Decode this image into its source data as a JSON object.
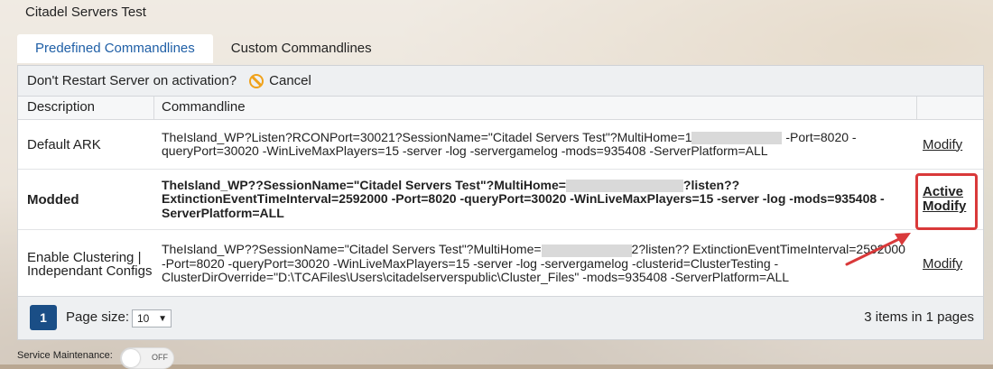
{
  "title": "Citadel Servers Test",
  "tabs": [
    {
      "label": "Predefined Commandlines",
      "active": true
    },
    {
      "label": "Custom Commandlines",
      "active": false
    }
  ],
  "toolbar": {
    "restart_text": "Don't Restart Server on activation?",
    "cancel_label": "Cancel",
    "cancel_icon": "cancel-icon"
  },
  "table": {
    "headers": [
      "Description",
      "Commandline"
    ],
    "rows": [
      {
        "description": "Default ARK",
        "cmd_pre": "TheIsland_WP?Listen?RCONPort=30021?SessionName=\"Citadel Servers Test\"?MultiHome=1",
        "cmd_post": " -Port=8020 -queryPort=30020 -WinLiveMaxPlayers=15 -server -log -servergamelog -mods=935408 -ServerPlatform=ALL",
        "action": "Modify"
      },
      {
        "description": "Modded",
        "cmd_pre": "TheIsland_WP??SessionName=\"Citadel Servers Test\"?MultiHome=",
        "cmd_post": "?listen?? ExtinctionEventTimeInterval=2592000 -Port=8020 -queryPort=30020 -WinLiveMaxPlayers=15 -server -log -mods=935408 -ServerPlatform=ALL",
        "action_line1": "Active",
        "action_line2": "Modify"
      },
      {
        "description": "Enable Clustering | Independant Configs",
        "cmd_pre": "TheIsland_WP??SessionName=\"Citadel Servers Test\"?MultiHome=",
        "cmd_post": "2?listen?? ExtinctionEventTimeInterval=2592000 -Port=8020 -queryPort=30020 -WinLiveMaxPlayers=15 -server -log -servergamelog -clusterid=ClusterTesting -ClusterDirOverride=\"D:\\TCAFiles\\Users\\citadelserverspublic\\Cluster_Files\" -mods=935408 -ServerPlatform=ALL",
        "action": "Modify"
      }
    ]
  },
  "pager": {
    "page": "1",
    "page_size_label": "Page size:",
    "page_size_value": "10",
    "items_info": "3 items in 1 pages"
  },
  "maintenance": {
    "label": "Service Maintenance:",
    "toggle_state": "OFF"
  },
  "colors": {
    "accent": "#1f5fa6",
    "pager_button": "#1a4e86",
    "cancel_icon": "#f0a21b",
    "annotation": "#d9393a"
  }
}
